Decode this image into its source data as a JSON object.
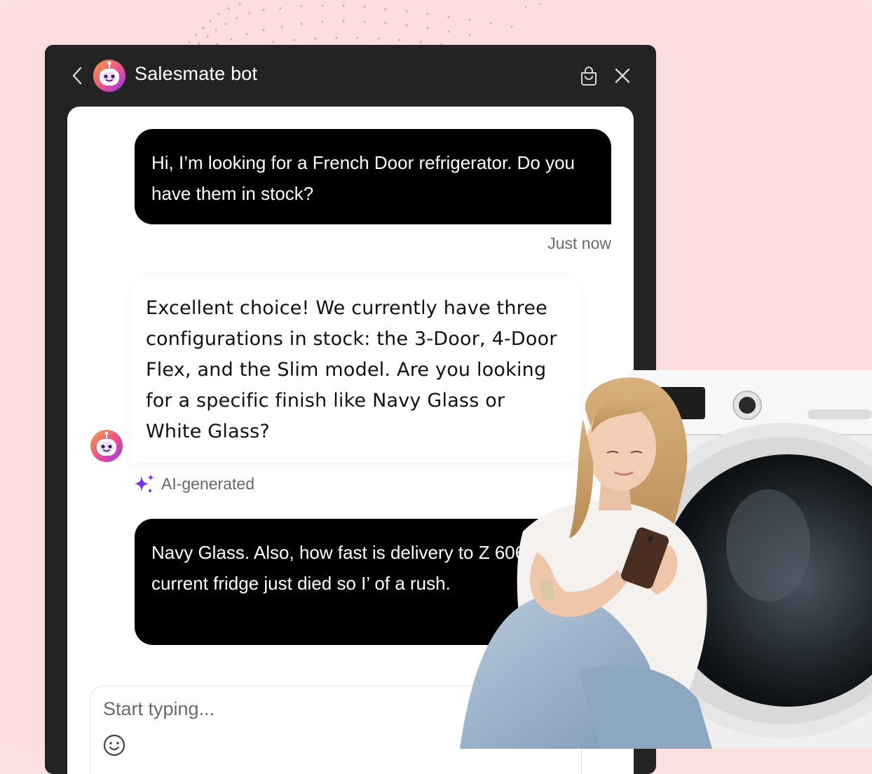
{
  "header": {
    "title": "Salesmate bot",
    "icons": {
      "back": "chevron-left-icon",
      "bag": "shopping-bag-icon",
      "close": "close-icon"
    }
  },
  "messages": [
    {
      "from": "user",
      "text": "Hi, I’m looking for a French Door refrigerator. Do you have them in stock?",
      "time": "Just now"
    },
    {
      "from": "bot",
      "text": "Excellent choice! We currently have three configurations in stock: the 3-Door, 4-Door Flex, and the Slim model. Are you looking for a specific finish like Navy Glass or White Glass?",
      "tag": "AI-generated"
    },
    {
      "from": "user",
      "text": "Navy Glass. Also, how fast is delivery to Z 60601? My current fridge just died so I’ of a rush."
    }
  ],
  "composer": {
    "placeholder": "Start typing..."
  },
  "colors": {
    "background": "#fcdede",
    "window": "#232323",
    "accent": "#7b2cf5"
  }
}
